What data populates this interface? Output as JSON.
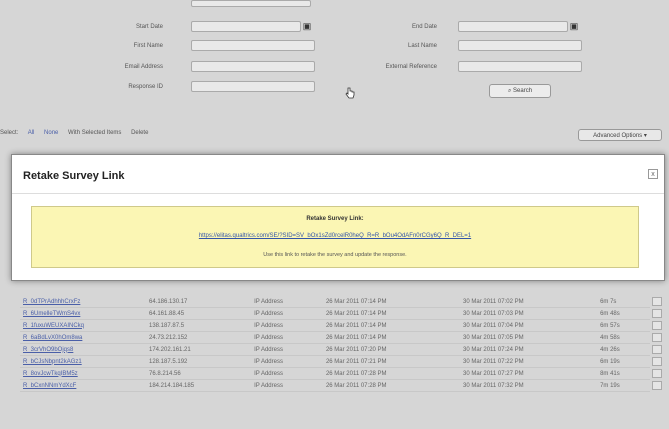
{
  "form": {
    "left_labels": [
      "Start Date",
      "First Name",
      "Email Address",
      "Response ID"
    ],
    "right_labels": [
      "End Date",
      "Last Name",
      "External Reference"
    ],
    "search_label": "Search",
    "calendar_icon": "calendar-icon"
  },
  "selection": {
    "prefix": "Select:",
    "options": [
      "All",
      "None",
      "With Selected Items",
      "Delete"
    ]
  },
  "advanced_options": "Advanced Options",
  "modal": {
    "title": "Retake Survey Link",
    "close_symbol": "x",
    "box_title": "Retake Survey Link:",
    "link": "https://elitas.qualtrics.com/SE/?SID=SV_bOx1sZd0rcelR0heQ_R=R_bOu4OdAFn0rCGy6Q_R_DEL=1",
    "help": "Use this link to retake the survey and update the response."
  },
  "table": {
    "rows": [
      [
        "R_0dTPrAdhhhCrxFz",
        "64.186.130.17",
        "IP Address",
        "26 Mar 2011 07:14 PM",
        "30 Mar 2011 07:02 PM",
        "6m 7s"
      ],
      [
        "R_6UmelleTWmS4vx",
        "64.161.88.45",
        "IP Address",
        "26 Mar 2011 07:14 PM",
        "30 Mar 2011 07:03 PM",
        "6m 48s"
      ],
      [
        "R_1fuxuWEUXAINCkq",
        "138.187.87.5",
        "IP Address",
        "26 Mar 2011 07:14 PM",
        "30 Mar 2011 07:04 PM",
        "6m 57s"
      ],
      [
        "R_6aBdLvX0hOm8wa",
        "24.73.212.152",
        "IP Address",
        "26 Mar 2011 07:14 PM",
        "30 Mar 2011 07:05 PM",
        "4m 58s"
      ],
      [
        "R_3crVhO9bOjqs8",
        "174.202.161.21",
        "IP Address",
        "26 Mar 2011 07:20 PM",
        "30 Mar 2011 07:24 PM",
        "4m 26s"
      ],
      [
        "R_bCJsNbpnt2kAGz1",
        "128.187.5.192",
        "IP Address",
        "26 Mar 2011 07:21 PM",
        "30 Mar 2011 07:22 PM",
        "6m 19s"
      ],
      [
        "R_8ovJcwTkqIBM5z",
        "76.8.214.56",
        "IP Address",
        "26 Mar 2011 07:28 PM",
        "30 Mar 2011 07:27 PM",
        "8m 41s"
      ],
      [
        "R_bCxnNNmYdXcF",
        "184.214.184.185",
        "IP Address",
        "26 Mar 2011 07:28 PM",
        "30 Mar 2011 07:32 PM",
        "7m 19s"
      ]
    ]
  },
  "colors": {
    "link": "#3355aa",
    "highlight": "#fbf6b4",
    "overlay": "#d6d6d6"
  }
}
